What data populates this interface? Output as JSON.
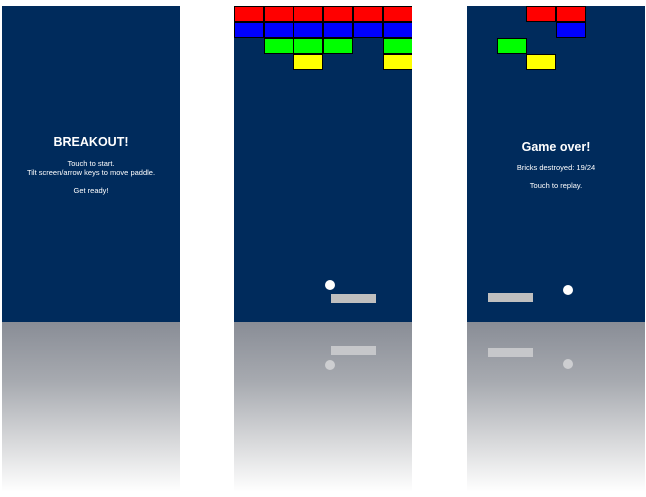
{
  "colors": {
    "background": "#002b5c",
    "red": "#ff0000",
    "blue": "#0000ff",
    "green": "#00ff00",
    "yellow": "#ffff00",
    "paddle": "#bfbfbf",
    "ball": "#ffffff"
  },
  "start_screen": {
    "title": "BREAKOUT!",
    "line1": "Touch to start.",
    "line2": "Tilt screen/arrow keys to move paddle.",
    "line3": "Get ready!"
  },
  "gameplay_screen": {
    "brick_rows": [
      [
        "red",
        "red",
        "red",
        "red",
        "red",
        "red"
      ],
      [
        "blue",
        "blue",
        "blue",
        "blue",
        "blue",
        "blue"
      ],
      [
        null,
        "green",
        "green",
        "green",
        null,
        "green"
      ],
      [
        null,
        null,
        "yellow",
        null,
        null,
        "yellow"
      ]
    ]
  },
  "gameover_screen": {
    "title": "Game over!",
    "score_text": "Bricks destroyed: 19/24",
    "replay_text": "Touch to replay.",
    "brick_rows": [
      [
        null,
        null,
        "red",
        "red",
        null,
        null
      ],
      [
        null,
        null,
        null,
        "blue",
        null,
        null
      ],
      [
        null,
        "green",
        null,
        null,
        null,
        null
      ],
      [
        null,
        null,
        "yellow",
        null,
        null,
        null
      ]
    ]
  }
}
